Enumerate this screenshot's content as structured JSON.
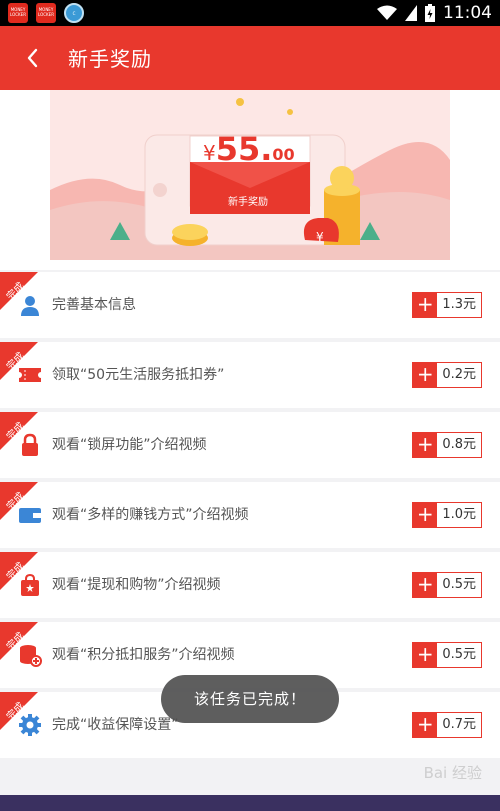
{
  "status_bar": {
    "apps": [
      "MONEY LOCKER",
      "MONEY LOCKER",
      "C"
    ],
    "time": "11:04"
  },
  "header": {
    "title": "新手奖励"
  },
  "banner": {
    "currency": "¥",
    "amount": "55.",
    "amount_decimal": "00",
    "envelope_label": "新手奖励",
    "bag_symbol": "¥"
  },
  "tasks": [
    {
      "label": "完善基本信息",
      "badge": "完成",
      "plus": "+",
      "reward": "1.3元",
      "icon": "user-icon"
    },
    {
      "label": "领取“50元生活服务抵扣券”",
      "badge": "完成",
      "plus": "+",
      "reward": "0.2元",
      "icon": "coupon-icon"
    },
    {
      "label": "观看“锁屏功能”介绍视频",
      "badge": "完成",
      "plus": "+",
      "reward": "0.8元",
      "icon": "lock-icon"
    },
    {
      "label": "观看“多样的赚钱方式”介绍视频",
      "badge": "完成",
      "plus": "+",
      "reward": "1.0元",
      "icon": "wallet-icon"
    },
    {
      "label": "观看“提现和购物”介绍视频",
      "badge": "完成",
      "plus": "+",
      "reward": "0.5元",
      "icon": "shopping-bag-icon"
    },
    {
      "label": "观看“积分抵扣服务”介绍视频",
      "badge": "完成",
      "plus": "+",
      "reward": "0.5元",
      "icon": "coins-icon"
    },
    {
      "label": "完成“收益保障设置”",
      "badge": "完成",
      "plus": "+",
      "reward": "0.7元",
      "icon": "gear-icon"
    }
  ],
  "toast": "该任务已完成！",
  "watermark": "Bai 经验",
  "colors": {
    "accent": "#e8382d",
    "icon_blue": "#3b86d6"
  }
}
